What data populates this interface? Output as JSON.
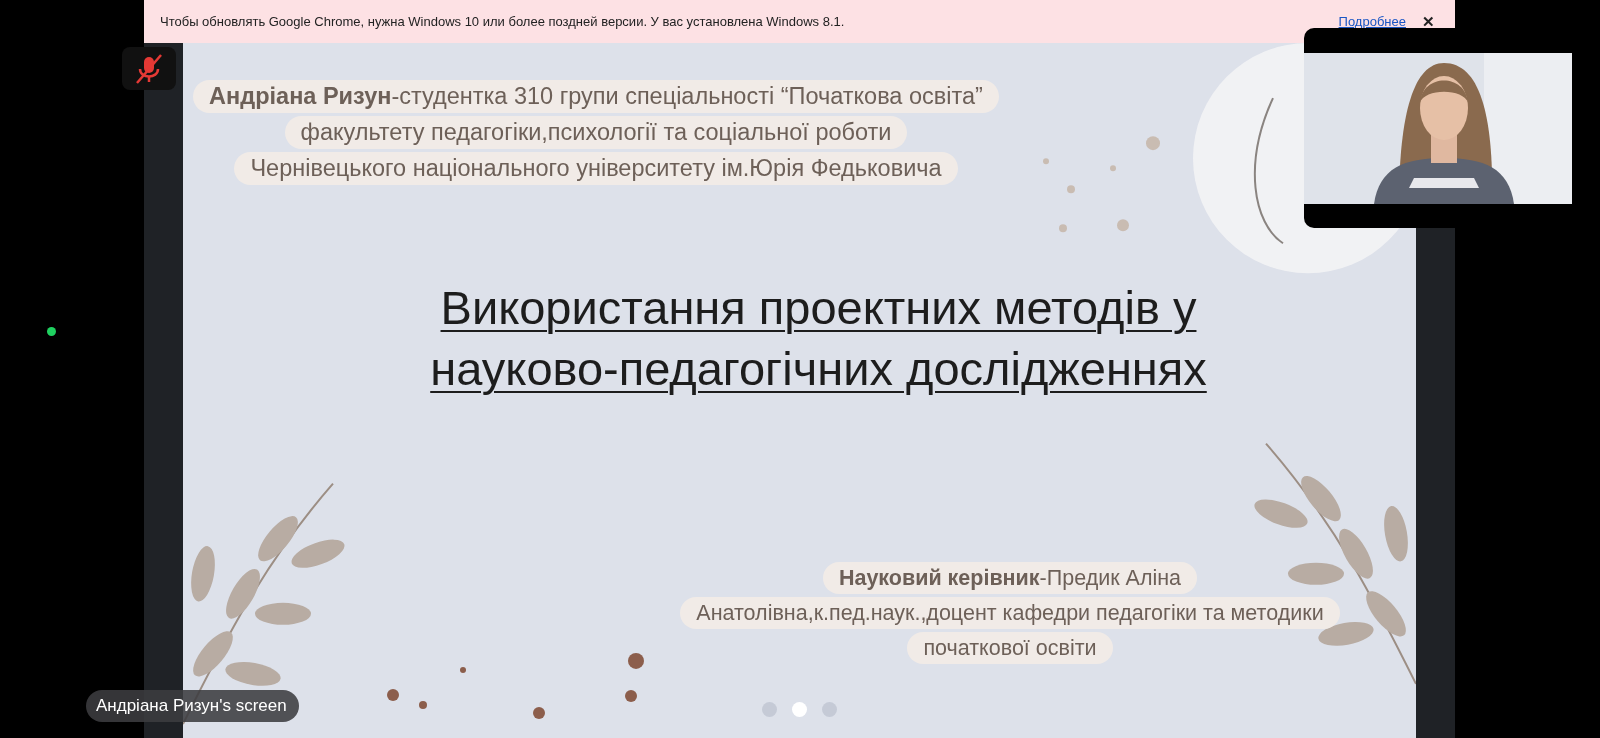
{
  "banner": {
    "message": "Чтобы обновлять Google Chrome, нужна Windows 10 или более поздней версии. У вас установлена Windows 8.1.",
    "link": "Подробнее",
    "close": "✕"
  },
  "slide": {
    "author_lines": [
      "**Андріана Ризун**-студентка 310 групи спеціальності “Початкова освіта”",
      "факультету педагогіки,психології та соціальної роботи",
      "Чернівецького національного університету ім.Юрія Федьковича"
    ],
    "title_lines": [
      "Використання проектних методів у",
      "науково-педагогічних дослідженнях"
    ],
    "supervisor_lines": [
      "**Науковий керівник**-Предик Аліна",
      "Анатолівна,к.пед.наук.,доцент кафедри педагогіки та методики",
      "початкової освіти"
    ],
    "pager": [
      {
        "selected": false
      },
      {
        "selected": true
      },
      {
        "selected": false
      }
    ]
  },
  "screen_label": "Андріана Ризун's screen"
}
